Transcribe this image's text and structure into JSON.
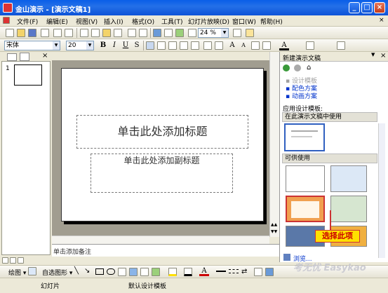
{
  "window": {
    "title": "金山演示 - [演示文稿1]",
    "min_label": "_",
    "max_label": "□",
    "close_label": "×"
  },
  "menu": {
    "items": [
      "文件(F)",
      "编辑(E)",
      "视图(V)",
      "插入(I)",
      "格式(O)",
      "工具(T)",
      "幻灯片放映(D)",
      "窗口(W)",
      "帮助(H)"
    ],
    "doc_close_label": "×"
  },
  "standard_toolbar": {
    "zoom_value": "24 %"
  },
  "format_toolbar": {
    "font_name": "宋体",
    "font_size": "20",
    "bold": "B",
    "italic": "I",
    "underline": "U",
    "strike": "S"
  },
  "slide": {
    "title_placeholder": "单击此处添加标题",
    "subtitle_placeholder": "单击此处添加副标题",
    "slide_number": "1"
  },
  "notes": {
    "placeholder": "单击添加备注"
  },
  "task_pane": {
    "title": "新建演示文稿",
    "links": {
      "design_template": "设计模板",
      "color_scheme": "配色方案",
      "animation_scheme": "动画方案"
    },
    "apply_label": "应用设计模板:",
    "section_used": "在此演示文稿中使用",
    "section_available": "可供使用",
    "browse": "浏览..."
  },
  "callout": {
    "text": "选择此项"
  },
  "draw_toolbar": {
    "draw_label": "绘图",
    "autoshape_label": "自选图形"
  },
  "status_bar": {
    "slide_label": "幻灯片",
    "template_label": "默认设计模板"
  },
  "watermark": "考无忧 Easykao",
  "colors": {
    "titlebar": "#0a5ee8",
    "callout_bg": "#ffe000",
    "callout_text": "#cc0000",
    "link": "#0033cc"
  }
}
